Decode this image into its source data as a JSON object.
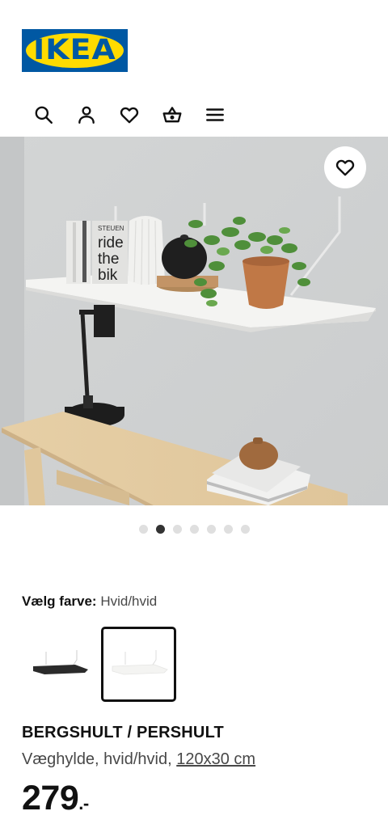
{
  "header": {
    "logo_text": "IKEA",
    "icons": [
      "search-icon",
      "user-icon",
      "heart-icon",
      "basket-icon",
      "menu-icon"
    ]
  },
  "gallery": {
    "slide_count": 7,
    "active_slide": 2,
    "favorite_icon": "heart-outline-icon",
    "book_cover_text": [
      "STEUEN",
      "ride",
      "the",
      "bik"
    ]
  },
  "color_selector": {
    "label": "Vælg farve:",
    "value": "Hvid/hvid",
    "options": [
      {
        "name": "black",
        "swatch_color": "#2b2b2b",
        "selected": false
      },
      {
        "name": "white",
        "swatch_color": "#f4f4f2",
        "selected": true
      }
    ]
  },
  "product": {
    "name": "BERGSHULT / PERSHULT",
    "description": "Væghylde, hvid/hvid,",
    "size": "120x30 cm",
    "price": "279",
    "price_suffix": ".-"
  },
  "colors": {
    "brand_blue": "#0058a3",
    "brand_yellow": "#ffdb00",
    "text": "#111111",
    "muted": "#484848"
  }
}
